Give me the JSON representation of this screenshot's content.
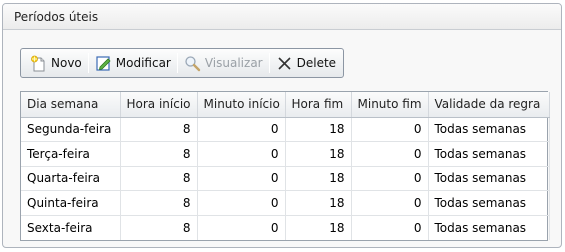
{
  "panel": {
    "title": "Períodos úteis"
  },
  "toolbar": {
    "new_label": "Novo",
    "new_icon": "new-document-icon",
    "edit_label": "Modificar",
    "edit_icon": "edit-icon",
    "view_label": "Visualizar",
    "view_icon": "magnifier-icon",
    "delete_label": "Delete",
    "delete_icon": "close-icon"
  },
  "table": {
    "columns": [
      "Dia semana",
      "Hora início",
      "Minuto início",
      "Hora fim",
      "Minuto fim",
      "Validade da regra"
    ],
    "rows": [
      [
        "Segunda-feira",
        "8",
        "0",
        "18",
        "0",
        "Todas semanas"
      ],
      [
        "Terça-feira",
        "8",
        "0",
        "18",
        "0",
        "Todas semanas"
      ],
      [
        "Quarta-feira",
        "8",
        "0",
        "18",
        "0",
        "Todas semanas"
      ],
      [
        "Quinta-feira",
        "8",
        "0",
        "18",
        "0",
        "Todas semanas"
      ],
      [
        "Sexta-feira",
        "8",
        "0",
        "18",
        "0",
        "Todas semanas"
      ]
    ]
  }
}
